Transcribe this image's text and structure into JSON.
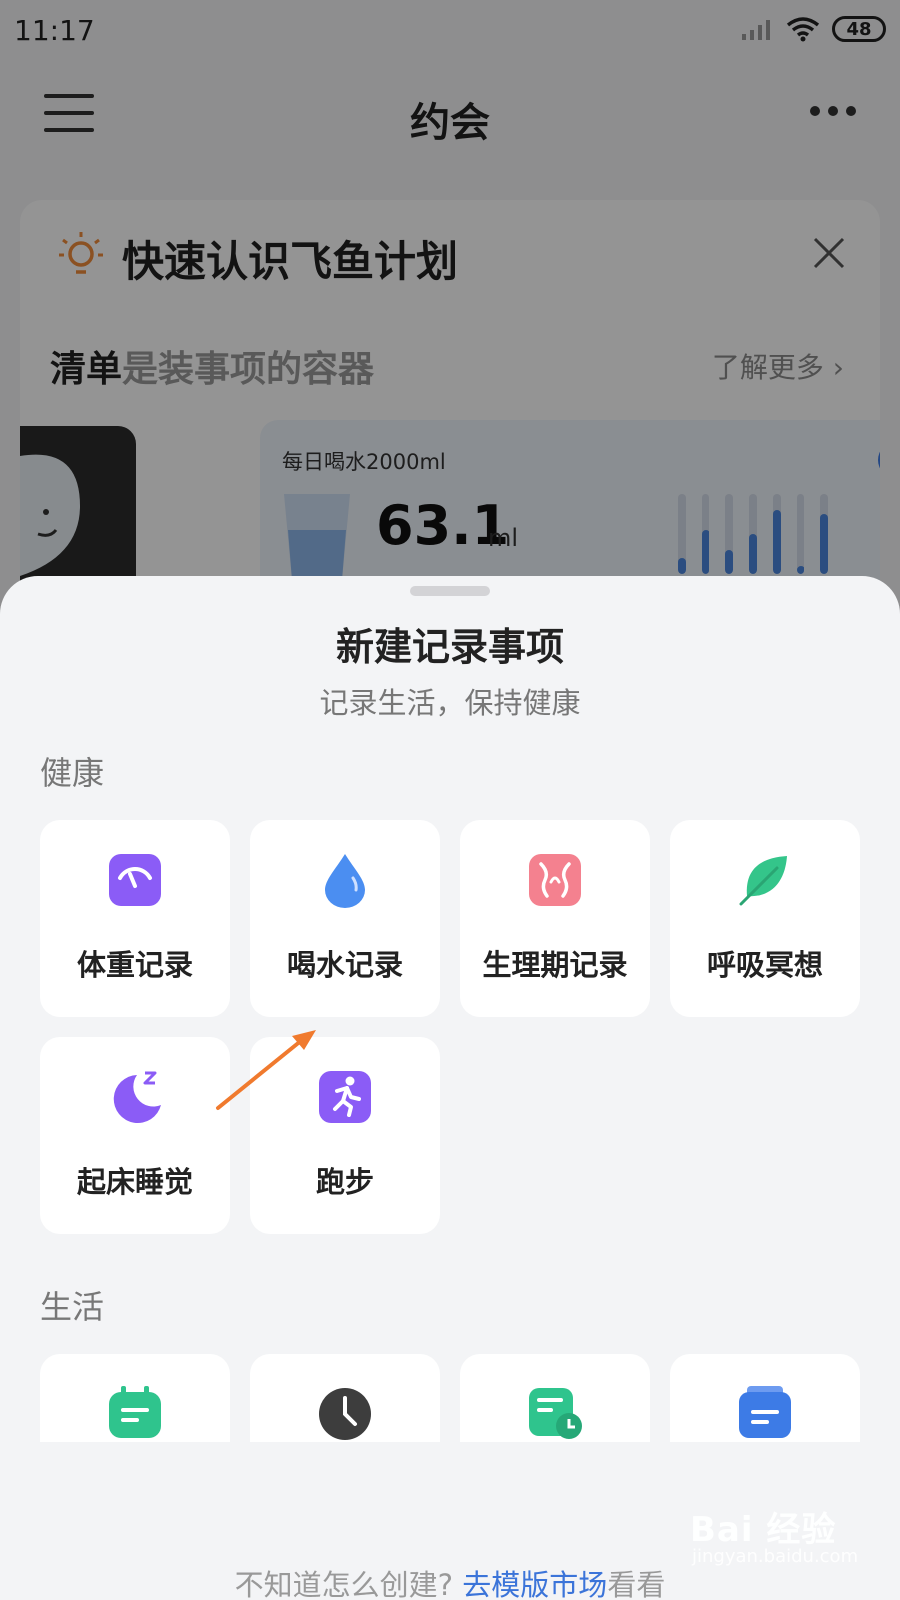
{
  "status": {
    "time": "11:17",
    "battery": "48"
  },
  "nav": {
    "title": "约会"
  },
  "intro": {
    "title": "快速认识飞鱼计划",
    "sub_strong": "清单",
    "sub_rest": "是装事项的容器",
    "learn_more": "了解更多 ›",
    "water_title": "每日喝水2000ml",
    "water_value": "63.1",
    "water_unit": "ml",
    "bar_levels": [
      0.2,
      0.55,
      0.3,
      0.5,
      0.8,
      0.1,
      0.75
    ]
  },
  "sheet": {
    "title": "新建记录事项",
    "subtitle": "记录生活，保持健康",
    "health_label": "健康",
    "life_label": "生活",
    "health_items": [
      {
        "label": "体重记录",
        "icon": "scale-icon",
        "color": "#8b5cf6"
      },
      {
        "label": "喝水记录",
        "icon": "water-drop-icon",
        "color": "#4b8ef1"
      },
      {
        "label": "生理期记录",
        "icon": "period-icon",
        "color": "#f4818f"
      },
      {
        "label": "呼吸冥想",
        "icon": "leaf-icon",
        "color": "#34c58a"
      },
      {
        "label": "起床睡觉",
        "icon": "moon-icon",
        "color": "#8b5cf6"
      },
      {
        "label": "跑步",
        "icon": "running-icon",
        "color": "#8b5cf6"
      }
    ],
    "life_items": [
      {
        "icon": "calendar-icon",
        "color": "#2fc48d"
      },
      {
        "icon": "clock-icon",
        "color": "#3d3d3d"
      },
      {
        "icon": "schedule-icon",
        "color": "#2fc48d"
      },
      {
        "icon": "note-icon",
        "color": "#3d7be6"
      }
    ],
    "footer_prefix": "不知道怎么创建?",
    "footer_link": "去模版市场",
    "footer_suffix": "看看"
  },
  "watermark": {
    "brand": "Bai 经验",
    "url": "jingyan.baidu.com"
  }
}
